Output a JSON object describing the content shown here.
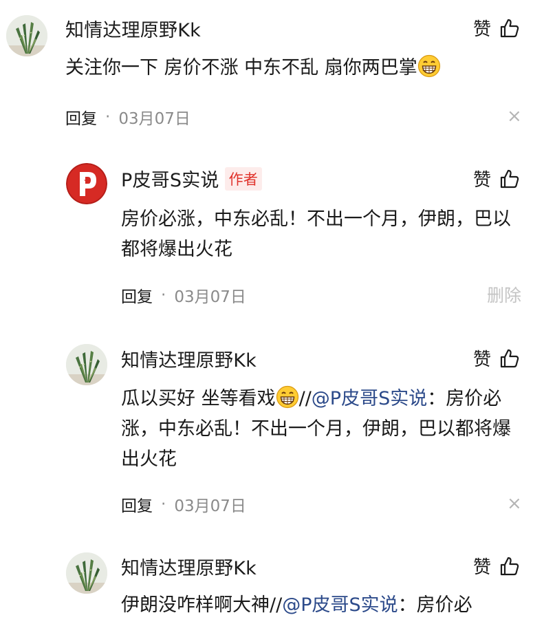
{
  "comments": [
    {
      "author": "知情达理原野Kk",
      "like_label": "赞",
      "text": "关注你一下 房价不涨 中东不乱 扇你两巴掌",
      "reply_label": "回复",
      "separator": "·",
      "date": "03月07日",
      "action": "×"
    },
    {
      "author": "P皮哥S实说",
      "badge": "作者",
      "like_label": "赞",
      "text_line1": "房价必涨，中东必乱！不出一个月，伊朗，巴以",
      "text_line2": "都将爆出火花",
      "reply_label": "回复",
      "separator": "·",
      "date": "03月07日",
      "action": "删除"
    },
    {
      "author": "知情达理原野Kk",
      "like_label": "赞",
      "text_prefix": "瓜以买好 坐等看戏",
      "slashes": "//",
      "mention": "@P皮哥S实说",
      "text_after_mention": "：房价必",
      "text_line2": "涨，中东必乱！不出一个月，伊朗，巴以都将爆",
      "text_line3": "出火花",
      "reply_label": "回复",
      "separator": "·",
      "date": "03月07日",
      "action": "×"
    },
    {
      "author": "知情达理原野Kk",
      "like_label": "赞",
      "text_prefix": "伊朗没咋样啊大神",
      "slashes": "//",
      "mention": "@P皮哥S实说",
      "text_after_mention": "：房价必"
    }
  ],
  "colors": {
    "accent_red": "#e0322b",
    "mention_blue": "#2c4a8a",
    "meta_gray": "#8a8a8a"
  }
}
